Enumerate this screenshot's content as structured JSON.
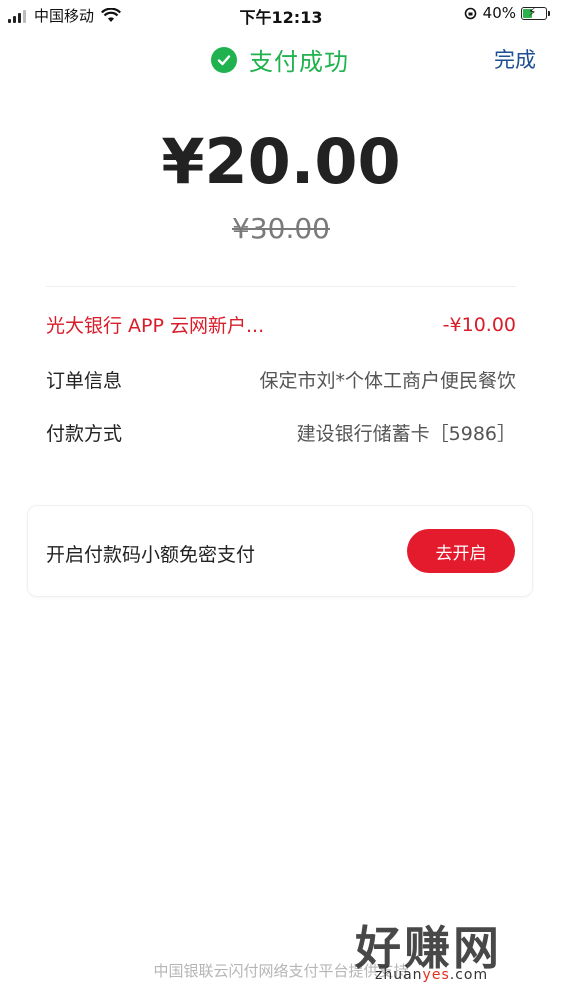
{
  "status_bar": {
    "carrier": "中国移动",
    "time": "下午12:13",
    "battery": "40%",
    "battery_level": 0.4
  },
  "header": {
    "title": "支付成功",
    "done_label": "完成",
    "success_color": "#1fb24e"
  },
  "payment": {
    "amount": "¥20.00",
    "original_amount": "¥30.00"
  },
  "details": {
    "discount_label": "光大银行 APP 云网新户...",
    "discount_value": "-¥10.00",
    "order_label": "订单信息",
    "order_value": "保定市刘*个体工商户便民餐饮",
    "pay_method_label": "付款方式",
    "pay_method_value": "建设银行储蓄卡［5986］"
  },
  "promo": {
    "text": "开启付款码小额免密支付",
    "button_label": "去开启",
    "button_color": "#e41a2d"
  },
  "footer": {
    "text": "中国银联云闪付网络支付平台提供支持"
  },
  "watermark": {
    "main": "好赚网",
    "sub_prefix": "zhuan",
    "sub_accent": "yes",
    "sub_suffix": ".com"
  }
}
